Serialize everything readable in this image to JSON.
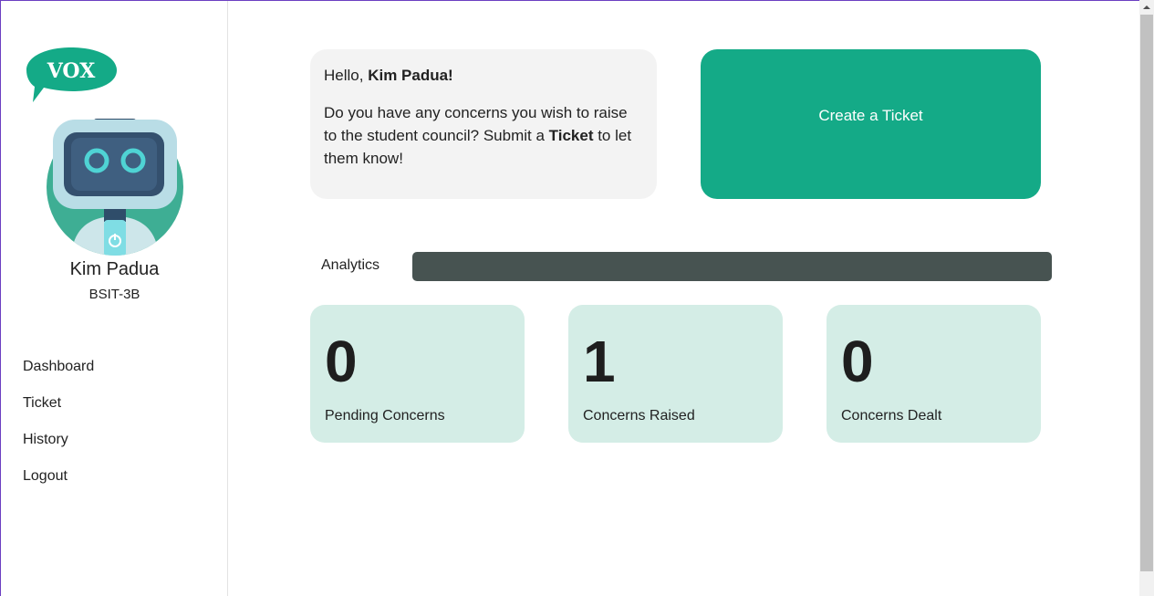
{
  "app": {
    "logo_text": "VOX"
  },
  "user": {
    "name": "Kim Padua",
    "section": "BSIT-3B"
  },
  "nav": {
    "items": [
      {
        "label": "Dashboard"
      },
      {
        "label": "Ticket"
      },
      {
        "label": "History"
      },
      {
        "label": "Logout"
      }
    ]
  },
  "welcome": {
    "greeting_prefix": "Hello, ",
    "greeting_name": "Kim Padua!",
    "message_prefix": "Do you have any concerns you wish to raise to the student council? Submit a ",
    "message_bold": "Ticket",
    "message_suffix": " to let them know!"
  },
  "actions": {
    "create_ticket_label": "Create a Ticket"
  },
  "analytics": {
    "label": "Analytics",
    "stats": [
      {
        "value": "0",
        "label": "Pending Concerns"
      },
      {
        "value": "1",
        "label": "Concerns Raised"
      },
      {
        "value": "0",
        "label": "Concerns Dealt"
      }
    ]
  },
  "colors": {
    "brand_green": "#14aa87",
    "stat_card_bg": "#d4ede6",
    "analytics_bar": "#475351",
    "welcome_bg": "#f3f3f3"
  },
  "icons": {
    "logo": "vox-speech-bubble-logo",
    "avatar": "robot-avatar-icon"
  }
}
